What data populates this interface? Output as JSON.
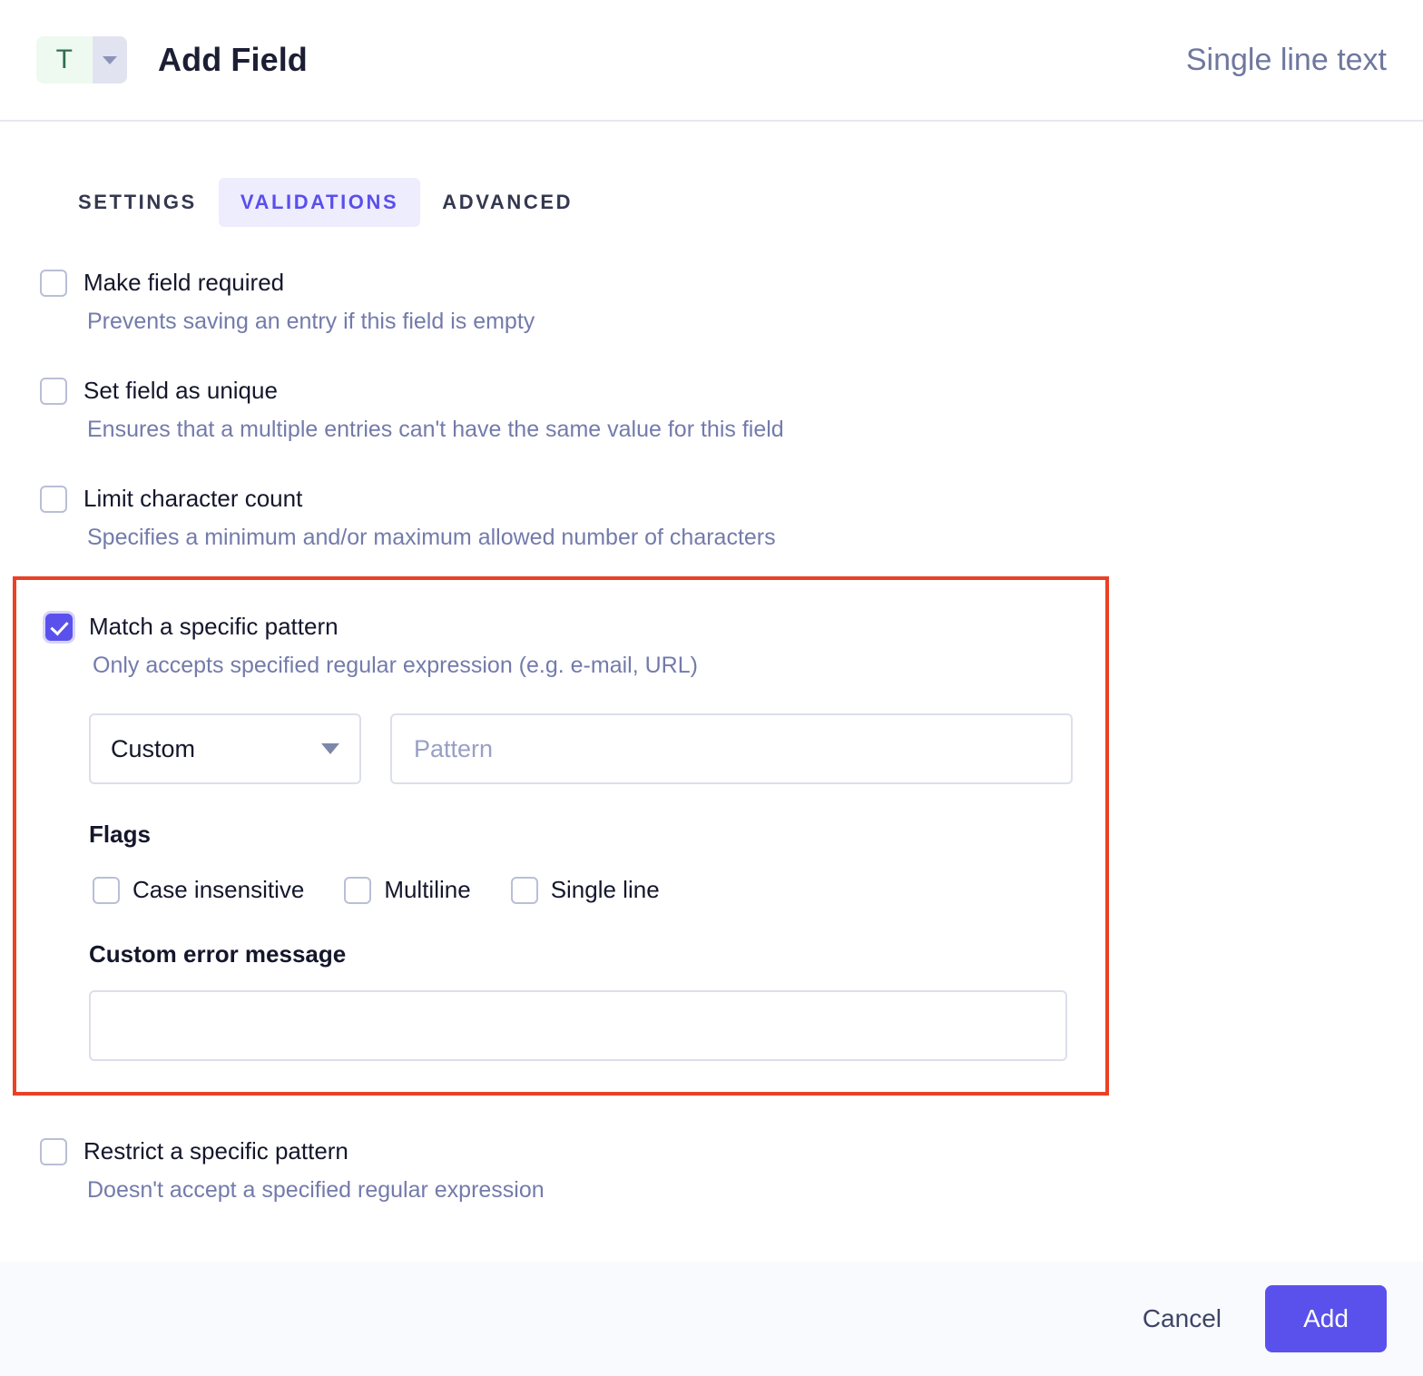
{
  "header": {
    "badge_letter": "T",
    "title": "Add Field",
    "field_type": "Single line text"
  },
  "tabs": [
    {
      "label": "SETTINGS",
      "active": false
    },
    {
      "label": "VALIDATIONS",
      "active": true
    },
    {
      "label": "ADVANCED",
      "active": false
    }
  ],
  "options": {
    "required": {
      "label": "Make field required",
      "desc": "Prevents saving an entry if this field is empty",
      "checked": false
    },
    "unique": {
      "label": "Set field as unique",
      "desc": "Ensures that a multiple entries can't have the same value for this field",
      "checked": false
    },
    "limit": {
      "label": "Limit character count",
      "desc": "Specifies a minimum and/or maximum allowed number of characters",
      "checked": false
    },
    "match": {
      "label": "Match a specific pattern",
      "desc": "Only accepts specified regular expression (e.g. e-mail, URL)",
      "checked": true,
      "preset_value": "Custom",
      "pattern_placeholder": "Pattern",
      "pattern_value": "",
      "flags_label": "Flags",
      "flags": [
        {
          "label": "Case insensitive",
          "checked": false
        },
        {
          "label": "Multiline",
          "checked": false
        },
        {
          "label": "Single line",
          "checked": false
        }
      ],
      "error_label": "Custom error message",
      "error_value": "",
      "error_placeholder": ""
    },
    "restrict": {
      "label": "Restrict a specific pattern",
      "desc": "Doesn't accept a specified regular expression",
      "checked": false
    }
  },
  "footer": {
    "cancel_label": "Cancel",
    "add_label": "Add"
  },
  "colors": {
    "accent": "#5a51ec",
    "accent_soft": "#eeedfd",
    "highlight_border": "#ea4126",
    "muted_text": "#737bab",
    "badge_green_bg": "#eef9f0",
    "badge_green_fg": "#2f6f4f"
  }
}
